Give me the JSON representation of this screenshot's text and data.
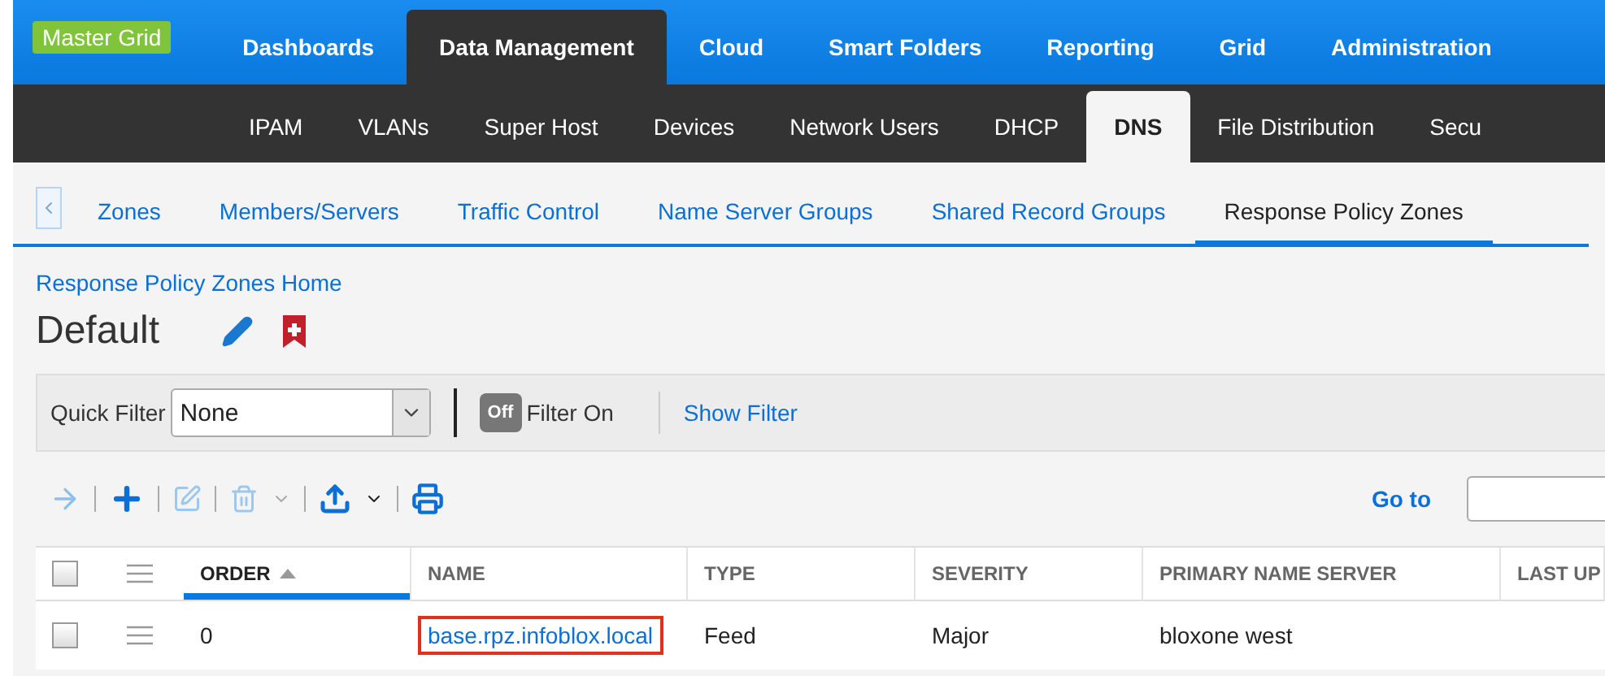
{
  "brand": "Master Grid",
  "main_nav": [
    {
      "label": "Dashboards",
      "selected": false
    },
    {
      "label": "Data Management",
      "selected": true
    },
    {
      "label": "Cloud",
      "selected": false
    },
    {
      "label": "Smart Folders",
      "selected": false
    },
    {
      "label": "Reporting",
      "selected": false
    },
    {
      "label": "Grid",
      "selected": false
    },
    {
      "label": "Administration",
      "selected": false
    }
  ],
  "sub_nav": [
    {
      "label": "IPAM",
      "selected": false
    },
    {
      "label": "VLANs",
      "selected": false
    },
    {
      "label": "Super Host",
      "selected": false
    },
    {
      "label": "Devices",
      "selected": false
    },
    {
      "label": "Network Users",
      "selected": false
    },
    {
      "label": "DHCP",
      "selected": false
    },
    {
      "label": "DNS",
      "selected": true
    },
    {
      "label": "File Distribution",
      "selected": false
    },
    {
      "label": "Secu",
      "selected": false
    }
  ],
  "dns_tabs": [
    {
      "label": "Zones",
      "selected": false
    },
    {
      "label": "Members/Servers",
      "selected": false
    },
    {
      "label": "Traffic Control",
      "selected": false
    },
    {
      "label": "Name Server Groups",
      "selected": false
    },
    {
      "label": "Shared Record Groups",
      "selected": false
    },
    {
      "label": "Response Policy Zones",
      "selected": true
    }
  ],
  "breadcrumb": "Response Policy Zones Home",
  "page_title": "Default",
  "filter_bar": {
    "quick_filter_label": "Quick Filter",
    "quick_filter_value": "None",
    "toggle": {
      "text": "Off",
      "on": false
    },
    "toggle_label": "Filter On",
    "show_filter": "Show Filter"
  },
  "goto": {
    "label": "Go to"
  },
  "table": {
    "select_all_checked": false,
    "columns": [
      {
        "label": "ORDER",
        "sorted": true
      },
      {
        "label": "NAME",
        "sorted": false
      },
      {
        "label": "TYPE",
        "sorted": false
      },
      {
        "label": "SEVERITY",
        "sorted": false
      },
      {
        "label": "PRIMARY NAME SERVER",
        "sorted": false
      },
      {
        "label": "LAST UP",
        "sorted": false
      }
    ],
    "rows": [
      {
        "checked": false,
        "order": "0",
        "name": "base.rpz.infoblox.local",
        "highlighted": true,
        "type": "Feed",
        "severity": "Major",
        "primary_name_server": "bloxone west"
      }
    ]
  }
}
